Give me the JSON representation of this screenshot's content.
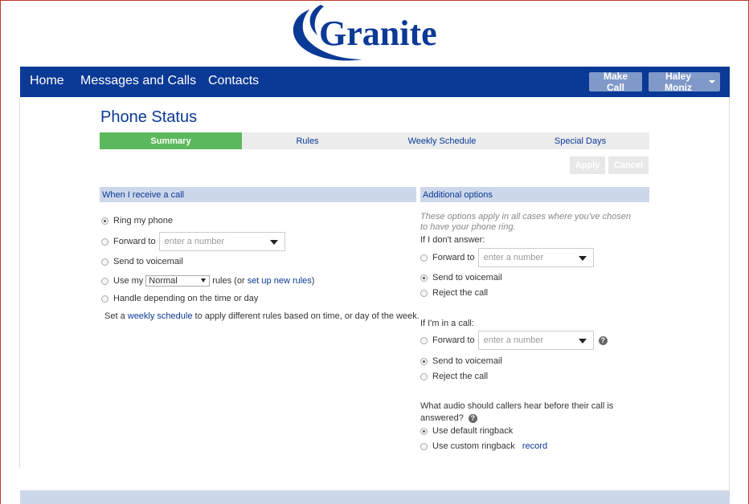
{
  "logo": {
    "text": "Granite"
  },
  "nav": {
    "home": "Home",
    "messages": "Messages and Calls",
    "contacts": "Contacts",
    "make_call": "Make Call",
    "user": "Haley Moniz"
  },
  "page_title": "Phone Status",
  "tabs": [
    {
      "label": "Summary",
      "active": true
    },
    {
      "label": "Rules",
      "active": false
    },
    {
      "label": "Weekly Schedule",
      "active": false
    },
    {
      "label": "Special Days",
      "active": false
    }
  ],
  "actions": {
    "apply": "Apply",
    "cancel": "Cancel"
  },
  "left": {
    "header": "When I receive a call",
    "ring": "Ring my phone",
    "forward": "Forward to",
    "forward_placeholder": "enter a number",
    "voicemail": "Send to voicemail",
    "use_my": "Use my",
    "rules_select": "Normal",
    "rules_suffix": "rules (or",
    "setup_link": "set up new rules",
    "close_paren": ")",
    "handle": "Handle depending on the time or day",
    "schedule_prefix": "Set a",
    "schedule_link": "weekly schedule",
    "schedule_suffix": "to apply different rules based on time, or day of the week."
  },
  "right": {
    "header": "Additional options",
    "note": "These options apply in all cases where you've chosen to have your phone ring.",
    "no_answer_label": "If I don't answer:",
    "forward": "Forward to",
    "forward_placeholder": "enter a number",
    "voicemail": "Send to voicemail",
    "reject": "Reject the call",
    "in_call_label": "If I'm in a call:",
    "audio_question_1": "What audio should callers hear before their call is",
    "audio_question_2": "answered?",
    "default_ringback": "Use default ringback",
    "custom_ringback": "Use custom ringback",
    "record_link": "record"
  },
  "colors": {
    "brand": "#0b3996",
    "active_tab": "#5cb85c",
    "section_header": "#cdd7ea"
  }
}
